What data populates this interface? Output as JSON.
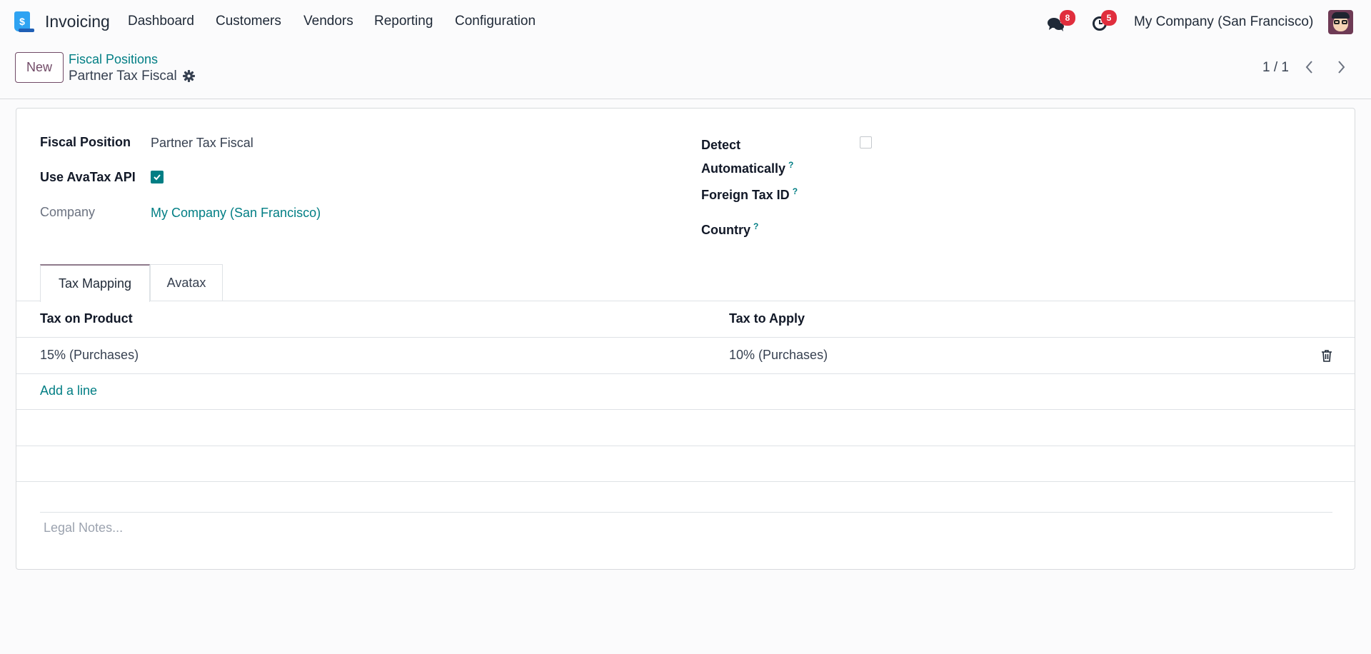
{
  "navbar": {
    "app_name": "Invoicing",
    "menu": [
      "Dashboard",
      "Customers",
      "Vendors",
      "Reporting",
      "Configuration"
    ],
    "messages_count": "8",
    "activities_count": "5",
    "company": "My Company (San Francisco)"
  },
  "control_panel": {
    "new_label": "New",
    "breadcrumb_parent": "Fiscal Positions",
    "breadcrumb_current": "Partner Tax Fiscal",
    "pager": "1 / 1"
  },
  "form": {
    "fiscal_position_label": "Fiscal Position",
    "fiscal_position_value": "Partner Tax Fiscal",
    "use_avatax_label": "Use AvaTax API",
    "use_avatax_checked": true,
    "company_label": "Company",
    "company_value": "My Company (San Francisco)",
    "detect_label_1": "Detect",
    "detect_label_2": "Automatically",
    "detect_checked": false,
    "foreign_tax_label": "Foreign Tax ID",
    "country_label": "Country",
    "help_mark": "?"
  },
  "tabs": [
    "Tax Mapping",
    "Avatax"
  ],
  "table": {
    "headers": [
      "Tax on Product",
      "Tax to Apply"
    ],
    "rows": [
      [
        "15% (Purchases)",
        "10% (Purchases)"
      ]
    ],
    "add_line": "Add a line"
  },
  "legal_notes_placeholder": "Legal Notes...",
  "colors": {
    "primary": "#714b67",
    "link": "#017e84",
    "badge": "#e02e3d"
  }
}
